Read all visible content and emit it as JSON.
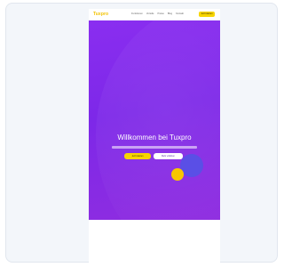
{
  "nav": {
    "logo": "Tuxpro",
    "links": [
      "Funktionen",
      "Vorteile",
      "Preise",
      "Blog",
      "Kontakt"
    ],
    "cta": "Jetzt starten"
  },
  "hero": {
    "title": "Willkommen bei Tuxpro",
    "primary_button": "Jetzt starten",
    "secondary_button": "Mehr erfahren"
  },
  "colors": {
    "accent": "#f7d500",
    "hero_background": "#8a2ef0",
    "blob_blue": "#5a4fe6",
    "blob_yellow": "#f7c700"
  }
}
